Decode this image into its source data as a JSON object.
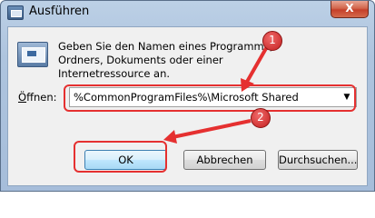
{
  "window": {
    "title": "Ausführen",
    "close_symbol": "X"
  },
  "dialog": {
    "description": "Geben Sie den Namen eines Programms, Ordners, Dokuments oder einer Internetressource an.",
    "open_label_prefix": "",
    "open_label_accesskey": "Ö",
    "open_label_rest": "ffnen:",
    "open_value": "%CommonProgramFiles%\\Microsoft Shared",
    "dropdown_symbol": "▼"
  },
  "buttons": {
    "ok": "OK",
    "cancel": "Abbrechen",
    "browse": "Durchsuchen..."
  },
  "annotations": {
    "step1": "1",
    "step2": "2",
    "highlight_color": "#e53030"
  }
}
